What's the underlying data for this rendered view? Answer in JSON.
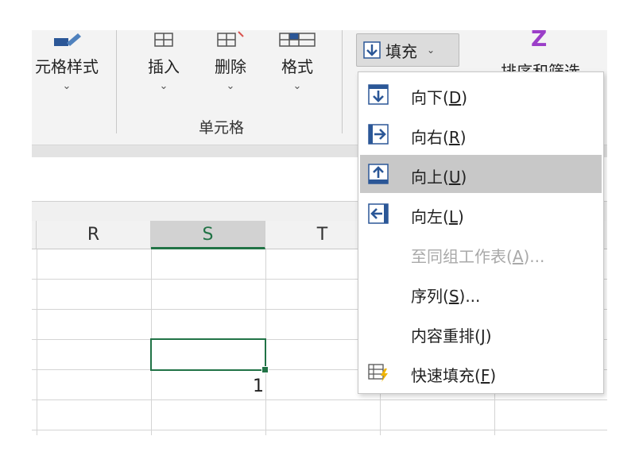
{
  "ribbon": {
    "cell_styles_label": "元格样式",
    "insert_label": "插入",
    "delete_label": "删除",
    "format_label": "格式",
    "cells_group_label": "单元格",
    "fill_label": "填充",
    "sort_filter_label": "排序和筛选"
  },
  "columns": [
    "R",
    "S",
    "T"
  ],
  "selected_column": "S",
  "cell_value": "1",
  "menu": {
    "items": [
      {
        "label": "向下(D)",
        "text": "向下(",
        "key": "D",
        "close": ")",
        "icon": "fill-down-icon",
        "disabled": false,
        "hover": false
      },
      {
        "label": "向右(R)",
        "text": "向右(",
        "key": "R",
        "close": ")",
        "icon": "fill-right-icon",
        "disabled": false,
        "hover": false
      },
      {
        "label": "向上(U)",
        "text": "向上(",
        "key": "U",
        "close": ")",
        "icon": "fill-up-icon",
        "disabled": false,
        "hover": true
      },
      {
        "label": "向左(L)",
        "text": "向左(",
        "key": "L",
        "close": ")",
        "icon": "fill-left-icon",
        "disabled": false,
        "hover": false
      },
      {
        "label": "至同组工作表(A)...",
        "text": "至同组工作表(",
        "key": "A",
        "close": ")...",
        "icon": "",
        "disabled": true,
        "hover": false
      },
      {
        "label": "序列(S)...",
        "text": "序列(",
        "key": "S",
        "close": ")...",
        "icon": "",
        "disabled": false,
        "hover": false
      },
      {
        "label": "内容重排(J)",
        "text": "内容重排(",
        "key": "J",
        "close": ")",
        "icon": "",
        "disabled": false,
        "hover": false
      },
      {
        "label": "快速填充(F)",
        "text": "快速填充(",
        "key": "F",
        "close": ")",
        "icon": "flash-fill-icon",
        "disabled": false,
        "hover": false
      }
    ]
  },
  "colors": {
    "accent_green": "#217346",
    "arrow_blue": "#2b5797",
    "hover_gray": "#c8c8c8"
  }
}
